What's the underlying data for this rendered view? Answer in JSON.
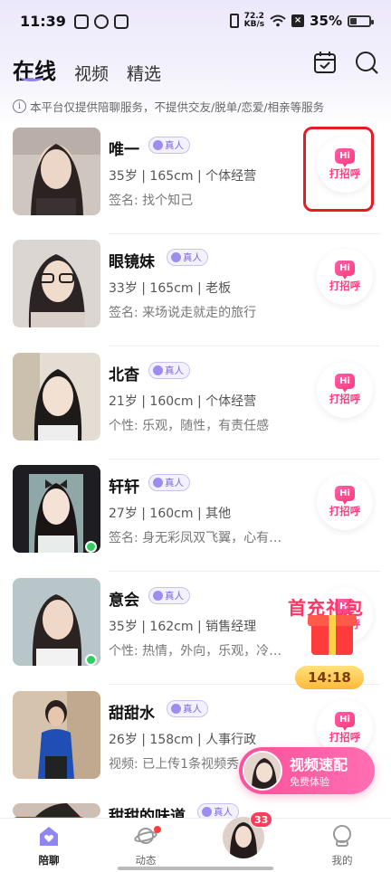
{
  "status_bar": {
    "time": "11:39",
    "network_speed": "72.2",
    "network_unit": "KB/s",
    "battery": "35%"
  },
  "header": {
    "tabs": [
      {
        "label": "在线"
      },
      {
        "label": "视频"
      },
      {
        "label": "精选"
      }
    ],
    "icons": {
      "calendar": "calendar-icon",
      "search": "search-icon"
    }
  },
  "notice": "本平台仅提供陪聊服务，不提供交友/脱单/恋爱/相亲等服务",
  "verified_badge": "真人",
  "greet": {
    "hi": "Hi",
    "label": "打招呼"
  },
  "users": [
    {
      "name": "唯一",
      "info": "35岁 | 165cm | 个体经营",
      "signature": "签名: 找个知己",
      "online": false
    },
    {
      "name": "眼镜妹",
      "info": "33岁 | 165cm | 老板",
      "signature": "签名: 来场说走就走的旅行",
      "online": false
    },
    {
      "name": "北杳",
      "info": "21岁 | 160cm | 个体经营",
      "signature": "个性: 乐观，随性，有责任感",
      "online": false
    },
    {
      "name": "轩轩",
      "info": "27岁 | 160cm | 其他",
      "signature": "签名: 身无彩凤双飞翼，心有…",
      "online": true
    },
    {
      "name": "意会",
      "info": "35岁 | 162cm | 销售经理",
      "signature": "个性: 热情，外向，乐观，冷…",
      "online": true
    },
    {
      "name": "甜甜水",
      "info": "26岁 | 158cm | 人事行政",
      "signature": "视频: 已上传1条视频秀",
      "online": false
    },
    {
      "name": "甜甜的味道",
      "info": "",
      "signature": "",
      "online": false
    }
  ],
  "promo": {
    "title": "首充礼包",
    "timer": "14:18"
  },
  "video_match": {
    "title": "视频速配",
    "subtitle": "免费体验"
  },
  "bottom_nav": {
    "items": [
      {
        "label": "陪聊"
      },
      {
        "label": "动态"
      },
      {
        "label": "我的"
      }
    ],
    "message_count": "33"
  },
  "colors": {
    "accent": "#ff3d7f",
    "brand_purple": "#8f7ff0",
    "online": "#2ecf5e",
    "highlight_frame": "#e51c23"
  }
}
